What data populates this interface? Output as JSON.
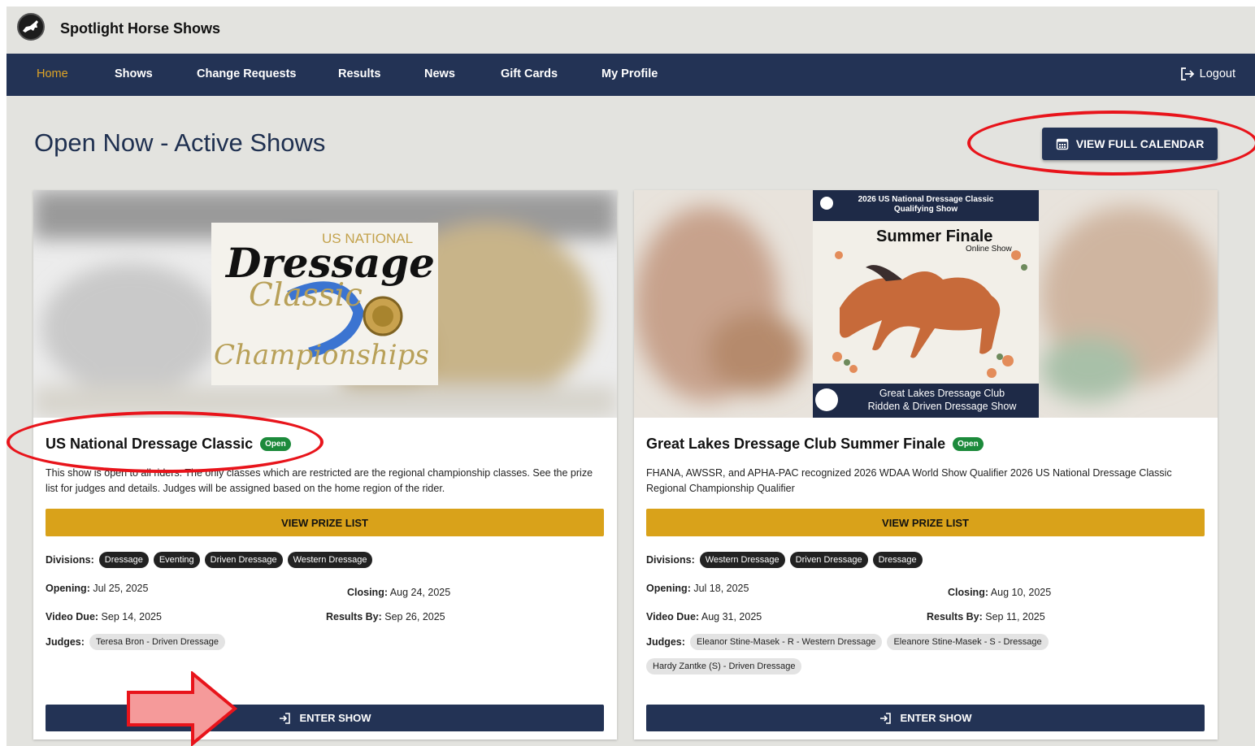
{
  "app": {
    "title": "Spotlight Horse Shows"
  },
  "nav": {
    "items": [
      "Home",
      "Shows",
      "Change Requests",
      "Results",
      "News",
      "Gift Cards",
      "My Profile"
    ],
    "logout": "Logout"
  },
  "page": {
    "title": "Open Now - Active Shows",
    "calendar_button": "VIEW FULL CALENDAR"
  },
  "colors": {
    "nav": "#233355",
    "accent": "#e0a526",
    "prize": "#d9a21a",
    "open": "#1c8a3b",
    "annotation": "#e8141b"
  },
  "shows": [
    {
      "title": "US National Dressage Classic",
      "badge": "Open",
      "description": "This show is open to all riders. The only classes which are restricted are the regional championship classes. See the prize list for judges and details. Judges will be assigned based on the home region of the rider.",
      "banner": {
        "line1": "US NATIONAL",
        "line2": "Dressage",
        "line3": "Classic",
        "line4": "Championships"
      },
      "prize_button": "VIEW PRIZE LIST",
      "divisions_label": "Divisions:",
      "divisions": [
        "Dressage",
        "Eventing",
        "Driven Dressage",
        "Western Dressage"
      ],
      "opening_label": "Opening:",
      "opening": "Jul 25, 2025",
      "closing_label": "Closing:",
      "closing": "Aug 24, 2025",
      "video_label": "Video Due:",
      "video": "Sep 14, 2025",
      "results_label": "Results By:",
      "results": "Sep 26, 2025",
      "judges_label": "Judges:",
      "judges": [
        "Teresa Bron - Driven Dressage"
      ],
      "enter_button": "ENTER SHOW"
    },
    {
      "title": "Great Lakes Dressage Club Summer Finale",
      "badge": "Open",
      "description": "FHANA, AWSSR, and APHA-PAC recognized 2026 WDAA World Show Qualifier 2026 US National Dressage Classic Regional Championship Qualifier",
      "banner": {
        "top1": "2026 US National Dressage Classic",
        "top2": "Qualifying Show",
        "headline": "Summer Finale",
        "sub": "Online Show",
        "bottom1": "Great Lakes Dressage Club",
        "bottom2": "Ridden & Driven Dressage Show"
      },
      "prize_button": "VIEW PRIZE LIST",
      "divisions_label": "Divisions:",
      "divisions": [
        "Western Dressage",
        "Driven Dressage",
        "Dressage"
      ],
      "opening_label": "Opening:",
      "opening": "Jul 18, 2025",
      "closing_label": "Closing:",
      "closing": "Aug 10, 2025",
      "video_label": "Video Due:",
      "video": "Aug 31, 2025",
      "results_label": "Results By:",
      "results": "Sep 11, 2025",
      "judges_label": "Judges:",
      "judges": [
        "Eleanor Stine-Masek - R - Western Dressage",
        "Eleanore Stine-Masek - S - Dressage",
        "Hardy Zantke (S) - Driven Dressage"
      ],
      "enter_button": "ENTER SHOW"
    }
  ]
}
